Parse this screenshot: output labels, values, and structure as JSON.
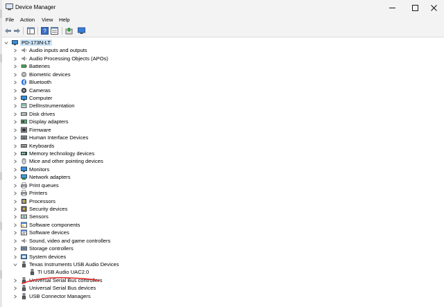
{
  "window": {
    "title": "Device Manager"
  },
  "menu": [
    "File",
    "Action",
    "View",
    "Help"
  ],
  "tree": {
    "root": "PD-173N-LT",
    "categories": [
      {
        "label": "Audio inputs and outputs",
        "icon": "speaker-icon"
      },
      {
        "label": "Audio Processing Objects (APOs)",
        "icon": "speaker-icon"
      },
      {
        "label": "Batteries",
        "icon": "battery-icon"
      },
      {
        "label": "Biometric devices",
        "icon": "fingerprint-icon"
      },
      {
        "label": "Bluetooth",
        "icon": "bluetooth-icon"
      },
      {
        "label": "Cameras",
        "icon": "camera-icon"
      },
      {
        "label": "Computer",
        "icon": "computer-icon"
      },
      {
        "label": "DellInstrumentation",
        "icon": "device-icon"
      },
      {
        "label": "Disk drives",
        "icon": "disk-drive-icon"
      },
      {
        "label": "Display adapters",
        "icon": "display-adapter-icon"
      },
      {
        "label": "Firmware",
        "icon": "firmware-icon"
      },
      {
        "label": "Human Interface Devices",
        "icon": "hid-icon"
      },
      {
        "label": "Keyboards",
        "icon": "keyboard-icon"
      },
      {
        "label": "Memory technology devices",
        "icon": "memory-icon"
      },
      {
        "label": "Mice and other pointing devices",
        "icon": "mouse-icon"
      },
      {
        "label": "Monitors",
        "icon": "monitor-icon"
      },
      {
        "label": "Network adapters",
        "icon": "network-adapter-icon"
      },
      {
        "label": "Print queues",
        "icon": "printer-icon"
      },
      {
        "label": "Printers",
        "icon": "printer-icon"
      },
      {
        "label": "Processors",
        "icon": "processor-icon"
      },
      {
        "label": "Security devices",
        "icon": "security-device-icon"
      },
      {
        "label": "Sensors",
        "icon": "sensor-icon"
      },
      {
        "label": "Software components",
        "icon": "software-component-icon"
      },
      {
        "label": "Software devices",
        "icon": "software-device-icon"
      },
      {
        "label": "Sound, video and game controllers",
        "icon": "speaker-icon"
      },
      {
        "label": "Storage controllers",
        "icon": "storage-controller-icon"
      },
      {
        "label": "System devices",
        "icon": "system-device-icon"
      },
      {
        "label": "Texas Instruments USB Audio Devices",
        "icon": "usb-icon",
        "expanded": true,
        "children": [
          {
            "label": "TI USB Audio UAC2.0",
            "icon": "usb-icon"
          }
        ]
      },
      {
        "label": "Universal Serial Bus controllers",
        "icon": "usb-icon",
        "struck": true
      },
      {
        "label": "Universal Serial Bus devices",
        "icon": "usb-icon"
      },
      {
        "label": "USB Connector Managers",
        "icon": "usb-icon"
      }
    ]
  },
  "colors": {
    "selection": "#cce4f7",
    "annotation": "#e02020"
  }
}
